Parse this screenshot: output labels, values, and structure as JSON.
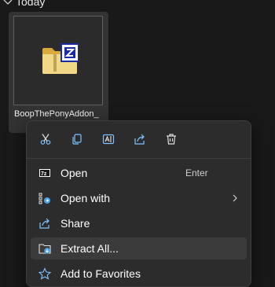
{
  "group": {
    "label": "Today"
  },
  "file": {
    "name": "BoopThePonyAddon_"
  },
  "menu": {
    "quick_actions": [
      {
        "name": "cut"
      },
      {
        "name": "copy"
      },
      {
        "name": "rename"
      },
      {
        "name": "share"
      },
      {
        "name": "delete"
      }
    ],
    "items": [
      {
        "label": "Open",
        "shortcut": "Enter"
      },
      {
        "label": "Open with"
      },
      {
        "label": "Share"
      },
      {
        "label": "Extract All..."
      },
      {
        "label": "Add to Favorites"
      }
    ]
  },
  "colors": {
    "accent": "#4aa0e6",
    "menu_bg": "#2c2c2c",
    "hover_bg": "#3b3b3b"
  }
}
